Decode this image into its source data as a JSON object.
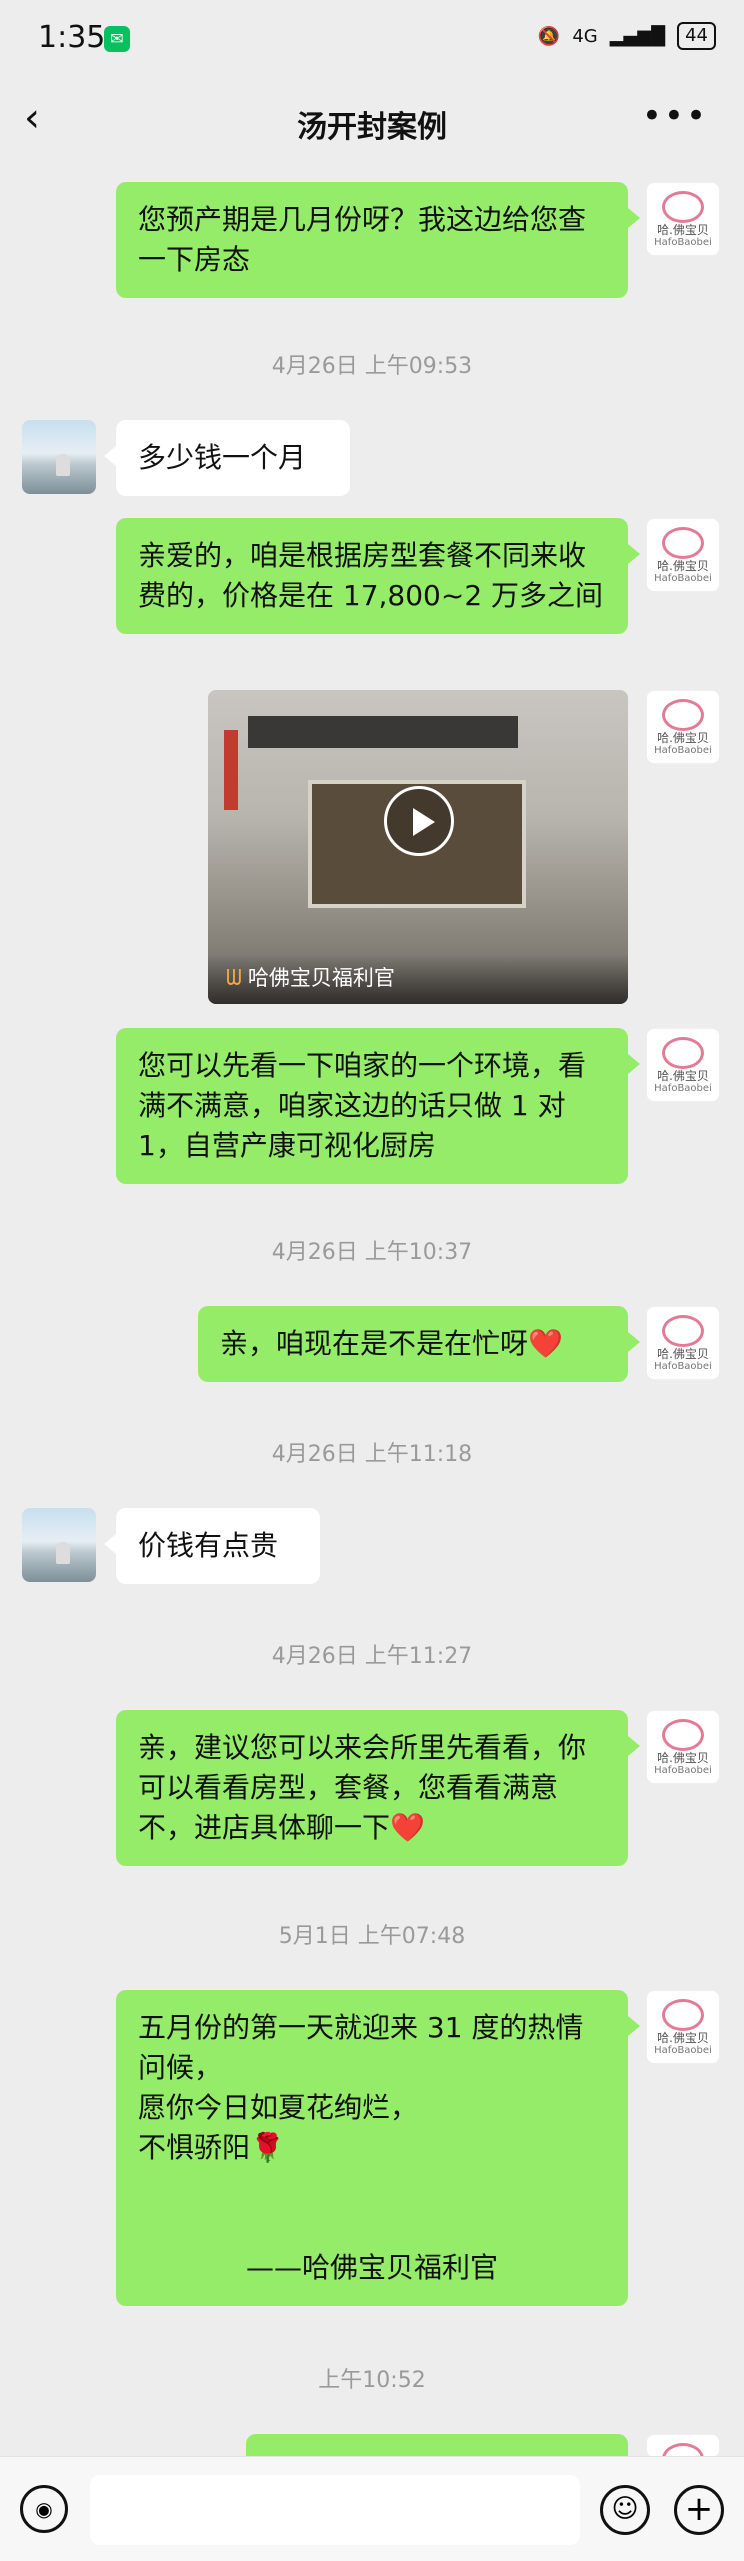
{
  "status_bar": {
    "time": "1:35",
    "network": "4G",
    "battery": "44"
  },
  "header": {
    "title": "汤开封案例",
    "back_icon": "chevron-left-icon",
    "more_icon": "more-dots-icon"
  },
  "contact_avatar": {
    "brand_cn": "哈.佛宝贝",
    "brand_en": "HafoBaobei"
  },
  "messages": [
    {
      "text": "您预产期是几月份呀？我这边给您查一下房态"
    },
    {
      "timestamp": "4月26日 上午09:53"
    },
    {
      "text": "多少钱一个月"
    },
    {
      "text": "亲爱的，咱是根据房型套餐不同来收费的，价格是在 17,800~2 万多之间"
    },
    {
      "video_source": "哈佛宝贝福利官"
    },
    {
      "text": "您可以先看一下咱家的一个环境，看满不满意，咱家这边的话只做 1 对 1，自营产康可视化厨房"
    },
    {
      "timestamp": "4月26日 上午10:37"
    },
    {
      "text": "亲，咱现在是不是在忙呀❤️"
    },
    {
      "timestamp": "4月26日 上午11:18"
    },
    {
      "text": "价钱有点贵"
    },
    {
      "timestamp": "4月26日 上午11:27"
    },
    {
      "text": "亲，建议您可以来会所里先看看，你可以看看房型，套餐，您看看满意不，进店具体聊一下❤️"
    },
    {
      "timestamp": "5月1日 上午07:48"
    },
    {
      "line1": "五月份的第一天就迎来 31 度的热情问候，",
      "line2": "愿你今日如夏花绚烂，",
      "line3": "不惧骄阳🌹",
      "signature": "——哈佛宝贝福利官"
    },
    {
      "timestamp": "上午10:52"
    }
  ]
}
